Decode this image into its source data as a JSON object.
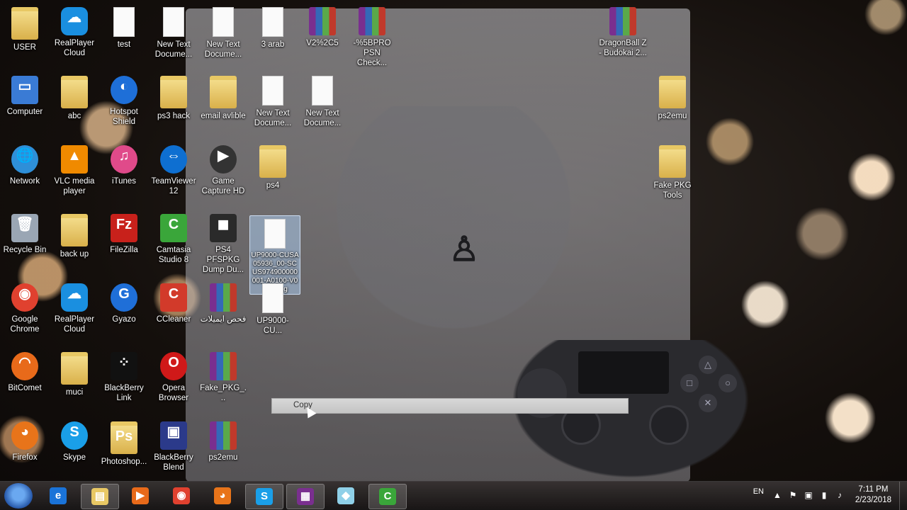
{
  "desktop": {
    "icons": [
      {
        "label": "USER",
        "kind": "folder-user",
        "color": "#d9b04a",
        "glyph": ""
      },
      {
        "label": "RealPlayer Cloud",
        "kind": "cloud",
        "color": "#1a8fe0",
        "glyph": "☁"
      },
      {
        "label": "test",
        "kind": "doc",
        "color": "#fafafa",
        "glyph": ""
      },
      {
        "label": "New Text Docume...",
        "kind": "doc",
        "color": "#fafafa",
        "glyph": ""
      },
      {
        "label": "New Text Docume...",
        "kind": "doc",
        "color": "#fafafa",
        "glyph": ""
      },
      {
        "label": "3 arab",
        "kind": "doc",
        "color": "#fafafa",
        "glyph": ""
      },
      {
        "label": "V2%2C5",
        "kind": "rar",
        "color": "#7a2f8f",
        "glyph": ""
      },
      {
        "label": "-%5BPRO PSN Check...",
        "kind": "rar",
        "color": "#7a2f8f",
        "glyph": ""
      },
      {
        "label": "DragonBall Z - Budokai 2...",
        "kind": "rar",
        "color": "#7a2f8f",
        "glyph": ""
      },
      {
        "label": "Computer",
        "kind": "app",
        "color": "#3a7bd5",
        "glyph": "▭"
      },
      {
        "label": "abc",
        "kind": "folder",
        "color": "#d9b04a",
        "glyph": ""
      },
      {
        "label": "Hotspot Shield",
        "kind": "round",
        "color": "#1e6fd8",
        "glyph": "◐"
      },
      {
        "label": "ps3 hack",
        "kind": "folder",
        "color": "#d9b04a",
        "glyph": ""
      },
      {
        "label": "email avlible",
        "kind": "folder",
        "color": "#d9b04a",
        "glyph": ""
      },
      {
        "label": "New Text Docume...",
        "kind": "doc",
        "color": "#fafafa",
        "glyph": ""
      },
      {
        "label": "New Text Docume...",
        "kind": "doc",
        "color": "#fafafa",
        "glyph": ""
      },
      {
        "label": "ps2emu",
        "kind": "folder",
        "color": "#d9b04a",
        "glyph": ""
      },
      {
        "label": "Network",
        "kind": "round",
        "color": "#2e8fd8",
        "glyph": "🌐"
      },
      {
        "label": "VLC media player",
        "kind": "app",
        "color": "#f08a00",
        "glyph": "▲"
      },
      {
        "label": "iTunes",
        "kind": "round",
        "color": "#e04a8a",
        "glyph": "♫"
      },
      {
        "label": "TeamViewer 12",
        "kind": "round",
        "color": "#0e6fd1",
        "glyph": "⇔"
      },
      {
        "label": "Game Capture HD",
        "kind": "round",
        "color": "#333333",
        "glyph": "▶"
      },
      {
        "label": "ps4",
        "kind": "folder",
        "color": "#d9b04a",
        "glyph": ""
      },
      {
        "label": "Fake PKG Tools",
        "kind": "folder",
        "color": "#d9b04a",
        "glyph": ""
      },
      {
        "label": "Recycle Bin",
        "kind": "app",
        "color": "#9aa6b4",
        "glyph": "🗑"
      },
      {
        "label": "back up",
        "kind": "folder",
        "color": "#d9b04a",
        "glyph": ""
      },
      {
        "label": "FileZilla",
        "kind": "app",
        "color": "#c8211b",
        "glyph": "Fz"
      },
      {
        "label": "Camtasia Studio 8",
        "kind": "app",
        "color": "#3aa63a",
        "glyph": "C"
      },
      {
        "label": "PS4 PFSPKG Dump Du...",
        "kind": "app",
        "color": "#2a2a2a",
        "glyph": "◼"
      },
      {
        "label": "UP9000-CUSA05936_00-SCUS974900000001-A0100-V0100.pkg",
        "kind": "doc",
        "color": "#fafafa",
        "glyph": "",
        "selected": true
      },
      {
        "label": "Google Chrome",
        "kind": "round",
        "color": "#e0412f",
        "glyph": "◉"
      },
      {
        "label": "RealPlayer Cloud",
        "kind": "cloud",
        "color": "#1a8fe0",
        "glyph": "☁"
      },
      {
        "label": "Gyazo",
        "kind": "round",
        "color": "#1f6fd8",
        "glyph": "G"
      },
      {
        "label": "CCleaner",
        "kind": "app",
        "color": "#d23a2a",
        "glyph": "C"
      },
      {
        "label": "فحص ايميلات",
        "kind": "rar",
        "color": "#7a2f8f",
        "glyph": ""
      },
      {
        "label": "UP9000-CU...",
        "kind": "doc",
        "color": "#fafafa",
        "glyph": ""
      },
      {
        "label": "BitComet",
        "kind": "round",
        "color": "#e86a1a",
        "glyph": "◠"
      },
      {
        "label": "muci",
        "kind": "folder",
        "color": "#d9b04a",
        "glyph": ""
      },
      {
        "label": "BlackBerry Link",
        "kind": "app",
        "color": "#111111",
        "glyph": "⁘"
      },
      {
        "label": "Opera Browser",
        "kind": "round",
        "color": "#d01919",
        "glyph": "O"
      },
      {
        "label": "Fake_PKG_...",
        "kind": "rar",
        "color": "#7a2f8f",
        "glyph": ""
      },
      {
        "label": "Firefox",
        "kind": "round",
        "color": "#e8741a",
        "glyph": "◕"
      },
      {
        "label": "Skype",
        "kind": "round",
        "color": "#1a9fe8",
        "glyph": "S"
      },
      {
        "label": "Photoshop...",
        "kind": "folder",
        "color": "#d9b04a",
        "glyph": "Ps"
      },
      {
        "label": "BlackBerry Blend",
        "kind": "app",
        "color": "#2b3a8a",
        "glyph": "▣"
      },
      {
        "label": "ps2emu",
        "kind": "rar",
        "color": "#7a2f8f",
        "glyph": ""
      }
    ]
  },
  "context_menu": {
    "items": [
      {
        "label": "Copy"
      }
    ]
  },
  "taskbar": {
    "buttons": [
      {
        "name": "internet-explorer",
        "glyph": "e",
        "color": "#1a73d8",
        "active": false
      },
      {
        "name": "file-explorer",
        "glyph": "▤",
        "color": "#e8c864",
        "active": true
      },
      {
        "name": "media-player",
        "glyph": "▶",
        "color": "#e86a1a",
        "active": false
      },
      {
        "name": "chrome",
        "glyph": "◉",
        "color": "#e0412f",
        "active": false
      },
      {
        "name": "firefox",
        "glyph": "◕",
        "color": "#e8741a",
        "active": false
      },
      {
        "name": "skype",
        "glyph": "S",
        "color": "#1a9fe8",
        "active": true
      },
      {
        "name": "winrar",
        "glyph": "▦",
        "color": "#7a2f8f",
        "active": true
      },
      {
        "name": "notepad",
        "glyph": "◆",
        "color": "#8fd0e8",
        "active": false
      },
      {
        "name": "camtasia",
        "glyph": "C",
        "color": "#3aa63a",
        "active": true
      }
    ],
    "tray": {
      "language": "EN",
      "time": "7:11 PM",
      "date": "2/23/2018"
    }
  }
}
